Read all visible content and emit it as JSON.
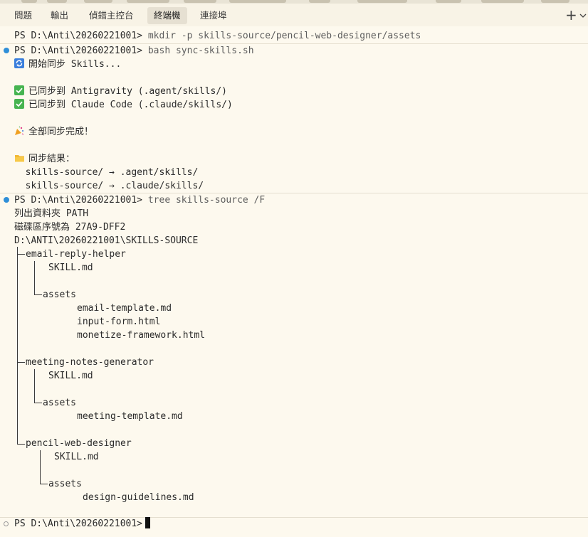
{
  "tabs": [
    {
      "label": "問題",
      "active": false
    },
    {
      "label": "輸出",
      "active": false
    },
    {
      "label": "偵錯主控台",
      "active": false
    },
    {
      "label": "終端機",
      "active": true
    },
    {
      "label": "連接埠",
      "active": false
    }
  ],
  "toolbar": {
    "plus_glyph": "+",
    "chevron_icon": "chevron-down-icon"
  },
  "terminal": {
    "prompt": "PS D:\\Anti\\20260221001>",
    "cmd1": "mkdir -p skills-source/pencil-web-designer/assets",
    "cmd2": "bash sync-skills.sh",
    "sync_start": "開始同步 Skills...",
    "synced_antigravity": "已同步到 Antigravity (.agent/skills/)",
    "synced_claude": "已同步到 Claude Code (.claude/skills/)",
    "all_done": "全部同步完成！",
    "result_title": "同步結果：",
    "result_1": "  skills-source/ → .agent/skills/",
    "result_2": "  skills-source/ → .claude/skills/",
    "cmd3": "tree skills-source /F",
    "tree_header_1": "列出資料夾 PATH",
    "tree_header_2": "磁碟區序號為 27A9-DFF2",
    "tree_root": "D:\\ANTI\\20260221001\\SKILLS-SOURCE",
    "tree": {
      "f1": "email-reply-helper",
      "f1_skill": "SKILL.md",
      "f1_assets": "assets",
      "f1_a1": "email-template.md",
      "f1_a2": "input-form.html",
      "f1_a3": "monetize-framework.html",
      "f2": "meeting-notes-generator",
      "f2_skill": "SKILL.md",
      "f2_assets": "assets",
      "f2_a1": "meeting-template.md",
      "f3": "pencil-web-designer",
      "f3_skill": "SKILL.md",
      "f3_assets": "assets",
      "f3_a1": "design-guidelines.md"
    }
  },
  "colors": {
    "background": "#fdf9ee",
    "tabbar": "#f8f3e6",
    "active_tab": "#e6e0d2",
    "prompt_dot": "#2f8fd8",
    "check_icon": "#46b450",
    "sync_icon": "#3b7fdc"
  }
}
